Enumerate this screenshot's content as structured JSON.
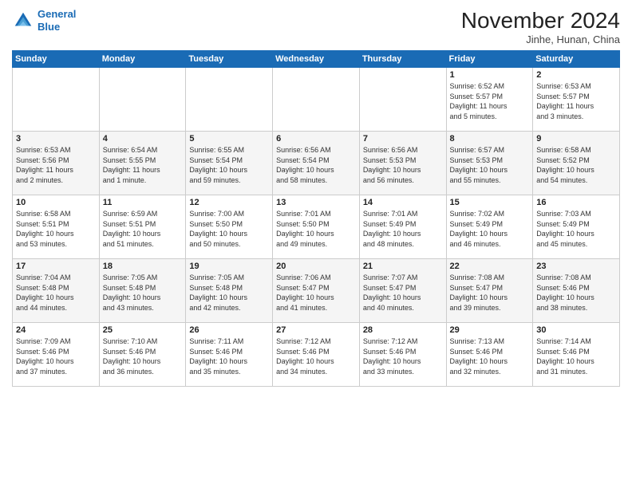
{
  "header": {
    "logo_line1": "General",
    "logo_line2": "Blue",
    "month": "November 2024",
    "location": "Jinhe, Hunan, China"
  },
  "weekdays": [
    "Sunday",
    "Monday",
    "Tuesday",
    "Wednesday",
    "Thursday",
    "Friday",
    "Saturday"
  ],
  "weeks": [
    [
      {
        "day": "",
        "info": ""
      },
      {
        "day": "",
        "info": ""
      },
      {
        "day": "",
        "info": ""
      },
      {
        "day": "",
        "info": ""
      },
      {
        "day": "",
        "info": ""
      },
      {
        "day": "1",
        "info": "Sunrise: 6:52 AM\nSunset: 5:57 PM\nDaylight: 11 hours\nand 5 minutes."
      },
      {
        "day": "2",
        "info": "Sunrise: 6:53 AM\nSunset: 5:57 PM\nDaylight: 11 hours\nand 3 minutes."
      }
    ],
    [
      {
        "day": "3",
        "info": "Sunrise: 6:53 AM\nSunset: 5:56 PM\nDaylight: 11 hours\nand 2 minutes."
      },
      {
        "day": "4",
        "info": "Sunrise: 6:54 AM\nSunset: 5:55 PM\nDaylight: 11 hours\nand 1 minute."
      },
      {
        "day": "5",
        "info": "Sunrise: 6:55 AM\nSunset: 5:54 PM\nDaylight: 10 hours\nand 59 minutes."
      },
      {
        "day": "6",
        "info": "Sunrise: 6:56 AM\nSunset: 5:54 PM\nDaylight: 10 hours\nand 58 minutes."
      },
      {
        "day": "7",
        "info": "Sunrise: 6:56 AM\nSunset: 5:53 PM\nDaylight: 10 hours\nand 56 minutes."
      },
      {
        "day": "8",
        "info": "Sunrise: 6:57 AM\nSunset: 5:53 PM\nDaylight: 10 hours\nand 55 minutes."
      },
      {
        "day": "9",
        "info": "Sunrise: 6:58 AM\nSunset: 5:52 PM\nDaylight: 10 hours\nand 54 minutes."
      }
    ],
    [
      {
        "day": "10",
        "info": "Sunrise: 6:58 AM\nSunset: 5:51 PM\nDaylight: 10 hours\nand 53 minutes."
      },
      {
        "day": "11",
        "info": "Sunrise: 6:59 AM\nSunset: 5:51 PM\nDaylight: 10 hours\nand 51 minutes."
      },
      {
        "day": "12",
        "info": "Sunrise: 7:00 AM\nSunset: 5:50 PM\nDaylight: 10 hours\nand 50 minutes."
      },
      {
        "day": "13",
        "info": "Sunrise: 7:01 AM\nSunset: 5:50 PM\nDaylight: 10 hours\nand 49 minutes."
      },
      {
        "day": "14",
        "info": "Sunrise: 7:01 AM\nSunset: 5:49 PM\nDaylight: 10 hours\nand 48 minutes."
      },
      {
        "day": "15",
        "info": "Sunrise: 7:02 AM\nSunset: 5:49 PM\nDaylight: 10 hours\nand 46 minutes."
      },
      {
        "day": "16",
        "info": "Sunrise: 7:03 AM\nSunset: 5:49 PM\nDaylight: 10 hours\nand 45 minutes."
      }
    ],
    [
      {
        "day": "17",
        "info": "Sunrise: 7:04 AM\nSunset: 5:48 PM\nDaylight: 10 hours\nand 44 minutes."
      },
      {
        "day": "18",
        "info": "Sunrise: 7:05 AM\nSunset: 5:48 PM\nDaylight: 10 hours\nand 43 minutes."
      },
      {
        "day": "19",
        "info": "Sunrise: 7:05 AM\nSunset: 5:48 PM\nDaylight: 10 hours\nand 42 minutes."
      },
      {
        "day": "20",
        "info": "Sunrise: 7:06 AM\nSunset: 5:47 PM\nDaylight: 10 hours\nand 41 minutes."
      },
      {
        "day": "21",
        "info": "Sunrise: 7:07 AM\nSunset: 5:47 PM\nDaylight: 10 hours\nand 40 minutes."
      },
      {
        "day": "22",
        "info": "Sunrise: 7:08 AM\nSunset: 5:47 PM\nDaylight: 10 hours\nand 39 minutes."
      },
      {
        "day": "23",
        "info": "Sunrise: 7:08 AM\nSunset: 5:46 PM\nDaylight: 10 hours\nand 38 minutes."
      }
    ],
    [
      {
        "day": "24",
        "info": "Sunrise: 7:09 AM\nSunset: 5:46 PM\nDaylight: 10 hours\nand 37 minutes."
      },
      {
        "day": "25",
        "info": "Sunrise: 7:10 AM\nSunset: 5:46 PM\nDaylight: 10 hours\nand 36 minutes."
      },
      {
        "day": "26",
        "info": "Sunrise: 7:11 AM\nSunset: 5:46 PM\nDaylight: 10 hours\nand 35 minutes."
      },
      {
        "day": "27",
        "info": "Sunrise: 7:12 AM\nSunset: 5:46 PM\nDaylight: 10 hours\nand 34 minutes."
      },
      {
        "day": "28",
        "info": "Sunrise: 7:12 AM\nSunset: 5:46 PM\nDaylight: 10 hours\nand 33 minutes."
      },
      {
        "day": "29",
        "info": "Sunrise: 7:13 AM\nSunset: 5:46 PM\nDaylight: 10 hours\nand 32 minutes."
      },
      {
        "day": "30",
        "info": "Sunrise: 7:14 AM\nSunset: 5:46 PM\nDaylight: 10 hours\nand 31 minutes."
      }
    ]
  ]
}
